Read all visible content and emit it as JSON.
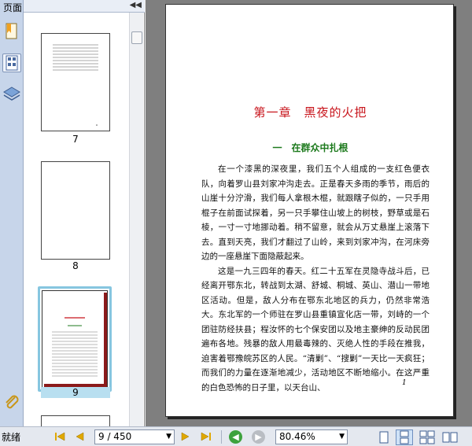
{
  "nav_pane": {
    "title": "页面",
    "collapse_icon": "double-chevron-left",
    "thumbnails": [
      {
        "label": "7"
      },
      {
        "label": "8"
      },
      {
        "label": "9"
      }
    ]
  },
  "document": {
    "chapter_title": "第一章　黑夜的火把",
    "section_title": "一　在群众中扎根",
    "paragraphs": [
      "在一个漆黑的深夜里，我们五个人组成的一支红色便衣队，向着罗山县刘家冲沟走去。正是春天多雨的季节，雨后的山崖十分泞滑，我们每人拿根木棍，就跟瞎子似的，一只手用棍子在前面试探着，另一只手攀住山坡上的树枝，野草或是石棱，一寸一寸地挪动着。稍不留意，就会从万丈悬崖上滚落下去。直到天亮，我们才翻过了山岭，来到刘家冲沟，在河床旁边的一座悬崖下面隐蔽起来。",
      "这是一九三四年的春天。红二十五军在灵隐寺战斗后，已经离开鄂东北，转战到太湖、舒城、桐城、英山、潜山一带地区活动。但是，敌人分布在鄂东北地区的兵力，仍然非常浩大。东北军的一个师驻在罗山县重镇宣化店一带，刘峙的一个团驻防经扶县；程汝怀的七个保安团以及地主豪绅的反动民团遍布各地。残暴的敌人用最毒辣的、灭绝人性的手段在推我，迫害着鄂豫皖苏区的人民。“清剿”、“搜剿”一天比一天疯狂；而我们的力量在逐渐地减少，活动地区不断地缩小。在这严重的白色恐怖的日子里，以天台山、"
    ],
    "page_number": "1"
  },
  "statusbar": {
    "status": "就绪",
    "page_field": "9 / 450",
    "zoom_field": "80.46%"
  },
  "colors": {
    "chapter_title": "#c8151c",
    "section_title": "#1d7a1d",
    "selected_thumbnail_border": "#86c6e0",
    "doc_background": "#7f7f7f"
  }
}
